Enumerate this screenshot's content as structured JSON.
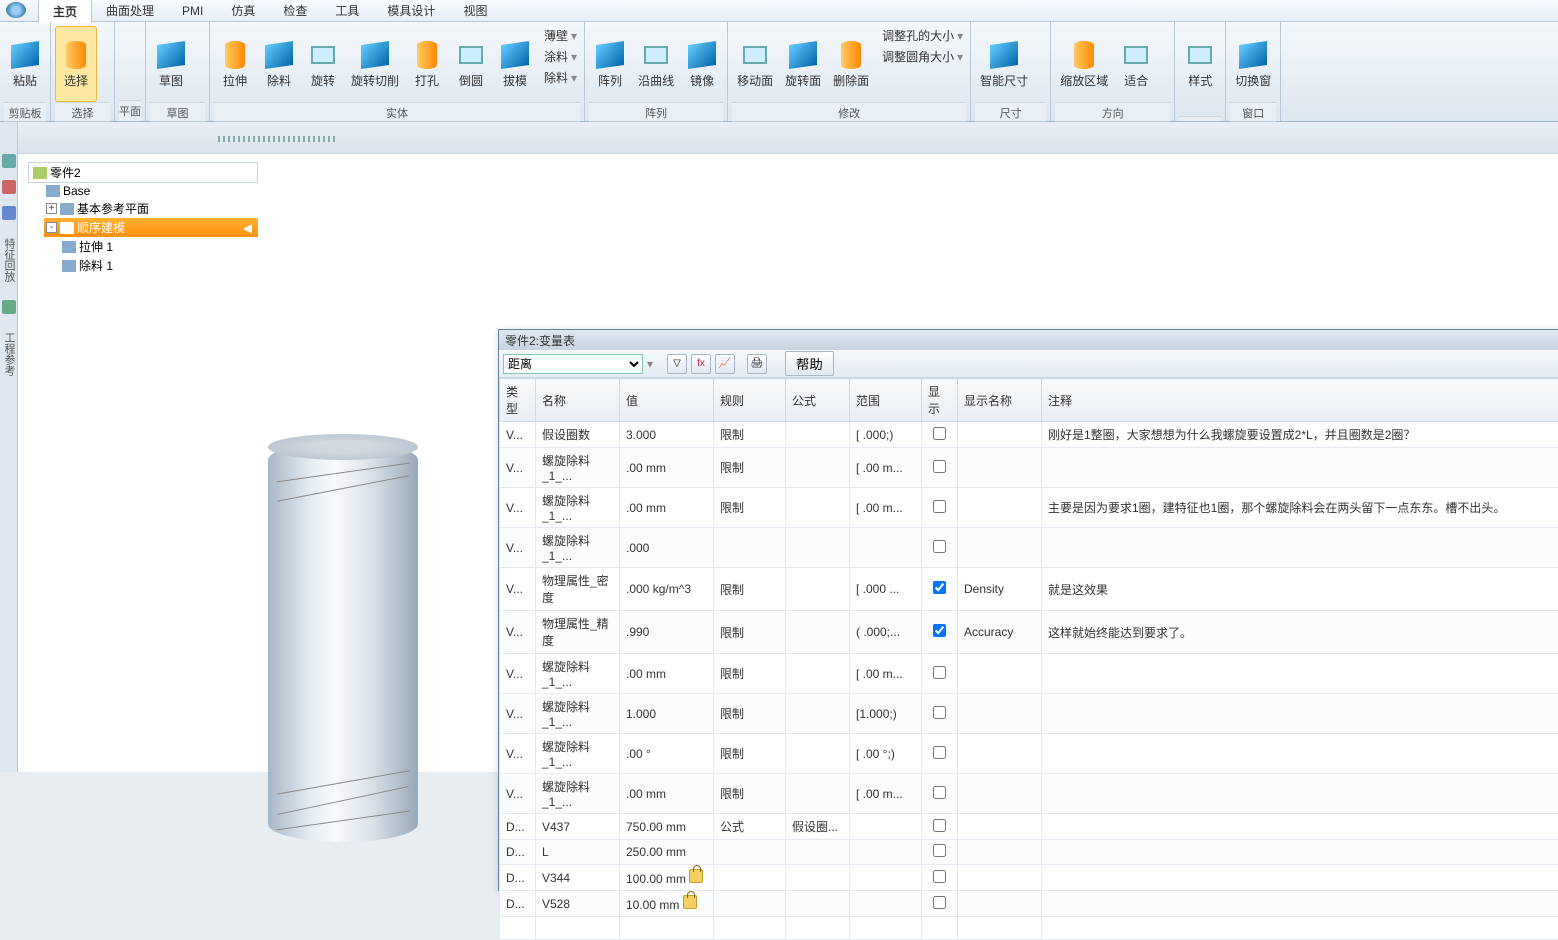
{
  "menu": {
    "tabs": [
      "主页",
      "曲面处理",
      "PMI",
      "仿真",
      "检查",
      "工具",
      "模具设计",
      "视图"
    ],
    "active": 0
  },
  "ribbon": {
    "groups": [
      {
        "label": "剪贴板",
        "buttons": [
          {
            "label": "粘贴"
          }
        ]
      },
      {
        "label": "选择",
        "buttons": [
          {
            "label": "选择",
            "selected": true
          }
        ]
      },
      {
        "label": "平面",
        "buttons": []
      },
      {
        "label": "草图",
        "buttons": [
          {
            "label": "草图"
          }
        ]
      },
      {
        "label": "实体",
        "buttons": [
          {
            "label": "拉伸"
          },
          {
            "label": "除料"
          },
          {
            "label": "旋转"
          },
          {
            "label": "旋转切削"
          },
          {
            "label": "打孔"
          },
          {
            "label": "倒圆"
          },
          {
            "label": "拔模"
          }
        ],
        "side": [
          "薄壁",
          "涂料",
          "除料"
        ]
      },
      {
        "label": "阵列",
        "buttons": [
          {
            "label": "阵列"
          },
          {
            "label": "沿曲线"
          },
          {
            "label": "镜像"
          }
        ]
      },
      {
        "label": "修改",
        "buttons": [
          {
            "label": "移动面"
          },
          {
            "label": "旋转面"
          },
          {
            "label": "删除面"
          }
        ],
        "side": [
          "调整孔的大小",
          "调整圆角大小"
        ]
      },
      {
        "label": "尺寸",
        "buttons": [
          {
            "label": "智能尺寸"
          }
        ]
      },
      {
        "label": "方向",
        "buttons": [
          {
            "label": "缩放区域"
          },
          {
            "label": "适合"
          }
        ]
      },
      {
        "label": "",
        "buttons": [
          {
            "label": "样式"
          }
        ]
      },
      {
        "label": "窗口",
        "buttons": [
          {
            "label": "切换窗"
          }
        ]
      }
    ]
  },
  "tree": {
    "root": "零件2",
    "items": [
      {
        "label": "Base",
        "indent": 1
      },
      {
        "label": "基本参考平面",
        "indent": 1,
        "exp": "+"
      },
      {
        "label": "顺序建模",
        "indent": 1,
        "exp": "-",
        "selected": true
      },
      {
        "label": "拉伸 1",
        "indent": 2
      },
      {
        "label": "除料 1",
        "indent": 2
      }
    ]
  },
  "vartable": {
    "title": "零件2:变量表",
    "filter_label": "距离",
    "help": "帮助",
    "headers": {
      "type": "类型",
      "name": "名称",
      "value": "值",
      "rule": "规则",
      "formula": "公式",
      "range": "范围",
      "show": "显示",
      "showname": "显示名称",
      "comment": "注释"
    },
    "rows": [
      {
        "type": "V...",
        "name": "假设圈数",
        "value": "3.000",
        "rule": "限制",
        "range": "[ .000;)",
        "show": false,
        "comment": "刚好是1整圈，大家想想为什么我螺旋要设置成2*L，并且圈数是2圈？"
      },
      {
        "type": "V...",
        "name": "螺旋除料_1_...",
        "value": ".00 mm",
        "rule": "限制",
        "range": "[ .00 m...",
        "show": false
      },
      {
        "type": "V...",
        "name": "螺旋除料_1_...",
        "value": ".00 mm",
        "rule": "限制",
        "range": "[ .00 m...",
        "show": false,
        "comment": "主要是因为要求1圈，建特征也1圈，那个螺旋除料会在两头留下一点东东。槽不出头。"
      },
      {
        "type": "V...",
        "name": "螺旋除料_1_...",
        "value": ".000",
        "rule": "",
        "range": "",
        "show": false
      },
      {
        "type": "V...",
        "name": "物理属性_密度",
        "value": ".000 kg/m^3",
        "rule": "限制",
        "range": "[ .000 ...",
        "show": true,
        "showname": "Density",
        "comment": "就是这效果"
      },
      {
        "type": "V...",
        "name": "物理属性_精度",
        "value": ".990",
        "rule": "限制",
        "range": "( .000;...",
        "show": true,
        "showname": "Accuracy",
        "comment": "这样就始终能达到要求了。"
      },
      {
        "type": "V...",
        "name": "螺旋除料_1_...",
        "value": ".00 mm",
        "rule": "限制",
        "range": "[ .00 m...",
        "show": false
      },
      {
        "type": "V...",
        "name": "螺旋除料_1_...",
        "value": "1.000",
        "rule": "限制",
        "range": "[1.000;)",
        "show": false
      },
      {
        "type": "V...",
        "name": "螺旋除料_1_...",
        "value": ".00 °",
        "rule": "限制",
        "range": "[ .00 °;)",
        "show": false
      },
      {
        "type": "V...",
        "name": "螺旋除料_1_...",
        "value": ".00 mm",
        "rule": "限制",
        "range": "[ .00 m...",
        "show": false
      },
      {
        "type": "D...",
        "name": "V437",
        "value": "750.00 mm",
        "rule": "公式",
        "formula": "假设圈...",
        "show": false
      },
      {
        "type": "D...",
        "name": "L",
        "value": "250.00 mm",
        "show": false
      },
      {
        "type": "D...",
        "name": "V344",
        "value": "100.00 mm",
        "lock": true,
        "show": false
      },
      {
        "type": "D...",
        "name": "V528",
        "value": "10.00 mm",
        "lock": true,
        "show": false
      }
    ]
  }
}
